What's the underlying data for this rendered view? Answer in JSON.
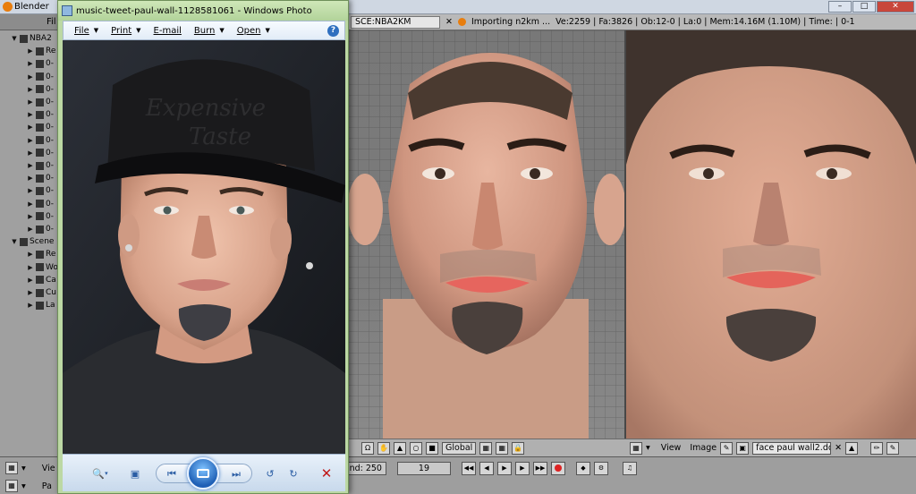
{
  "blender": {
    "title": "Blender",
    "window_buttons": {
      "minimize": "–",
      "maximize": "□",
      "close": "✕"
    },
    "info_bar": {
      "scene": "SCE:NBA2KM",
      "scene_close": "✕",
      "job": "Importing n2km ...",
      "stats": "Ve:2259 | Fa:3826 | Ob:12-0 | La:0 | Mem:14.16M (1.10M) | Time: | 0-1"
    },
    "outliner": {
      "header_label": "Fil",
      "rows": [
        {
          "label": "NBA2",
          "icon": "scene-icon"
        },
        {
          "label": "Re",
          "icon": "mesh-icon"
        },
        {
          "label": "0-",
          "icon": "mesh-icon"
        },
        {
          "label": "0-",
          "icon": "armature-icon"
        },
        {
          "label": "0-",
          "icon": "mesh-icon"
        },
        {
          "label": "0-",
          "icon": "mesh-icon"
        },
        {
          "label": "0-",
          "icon": "mesh-icon"
        },
        {
          "label": "0-",
          "icon": "mesh-icon"
        },
        {
          "label": "0-",
          "icon": "mesh-icon"
        },
        {
          "label": "0-",
          "icon": "mesh-icon"
        },
        {
          "label": "0-",
          "icon": "mesh-icon"
        },
        {
          "label": "0-",
          "icon": "mesh-icon"
        },
        {
          "label": "0-",
          "icon": "mesh-icon"
        },
        {
          "label": "0-",
          "icon": "mesh-icon"
        },
        {
          "label": "0-",
          "icon": "mesh-icon"
        },
        {
          "label": "0-",
          "icon": "mesh-icon"
        },
        {
          "label": "Scene",
          "icon": "scene-icon"
        },
        {
          "label": "Re",
          "icon": "render-icon"
        },
        {
          "label": "Wo",
          "icon": "world-icon"
        },
        {
          "label": "Ca",
          "icon": "camera-icon"
        },
        {
          "label": "Cu",
          "icon": "cube-icon"
        },
        {
          "label": "La",
          "icon": "lamp-icon"
        }
      ]
    },
    "viewport_left_header": {
      "orientation": "Global"
    },
    "image_editor_header": {
      "view": "View",
      "image": "Image",
      "image_name": "face paul wall2.dds",
      "image_close": "✕"
    },
    "bottom": {
      "row1_label": "Vie",
      "end_frame": "nd: 250",
      "current_frame": "19",
      "row2_label": "Pa"
    }
  },
  "photo_viewer": {
    "title": "music-tweet-paul-wall-1128581061 - Windows Photo",
    "menu": [
      {
        "label": "File",
        "name": "file-menu"
      },
      {
        "label": "Print",
        "name": "print-menu"
      },
      {
        "label": "E-mail",
        "name": "email-menu"
      },
      {
        "label": "Burn",
        "name": "burn-menu"
      },
      {
        "label": "Open",
        "name": "open-menu"
      }
    ],
    "help": "?",
    "hat_text": "Expensive Taste"
  }
}
